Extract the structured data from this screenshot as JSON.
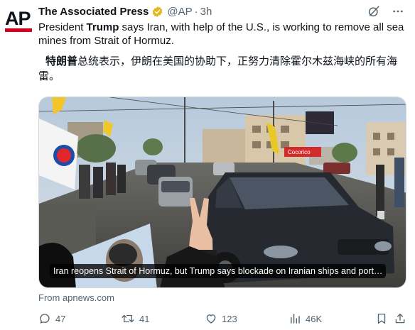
{
  "post": {
    "author_name": "The Associated Press",
    "author_handle": "@AP",
    "separator": "·",
    "time": "3h",
    "avatar_text": "AP",
    "text_en_part1": "President ",
    "text_en_bold": "Trump",
    "text_en_part2": " says Iran, with help of the U.S., is working to remove all sea mines from Strait of Hormuz.",
    "text_zh_bold": "特朗普",
    "text_zh_rest": "总统表示，伊朗在美国的协助下，正努力清除霍尔木兹海峡的所有海雷。"
  },
  "media": {
    "caption": "Iran reopens Strait of Hormuz, but Trump says blockade on Iranian ships and port…",
    "sign_text": "Cocorico"
  },
  "source_text": "From apnews.com",
  "actions": {
    "replies": "47",
    "reposts": "41",
    "likes": "123",
    "views": "46K"
  },
  "icons": {
    "verified": "verified-badge-icon",
    "grok": "grok-icon",
    "more": "more-icon",
    "reply": "reply-icon",
    "repost": "repost-icon",
    "like": "heart-icon",
    "views": "views-icon",
    "bookmark": "bookmark-icon",
    "share": "share-icon"
  },
  "colors": {
    "brand_red": "#d6001c",
    "verified_gold": "#e2b719",
    "text_primary": "#0f1419",
    "text_secondary": "#536471"
  }
}
